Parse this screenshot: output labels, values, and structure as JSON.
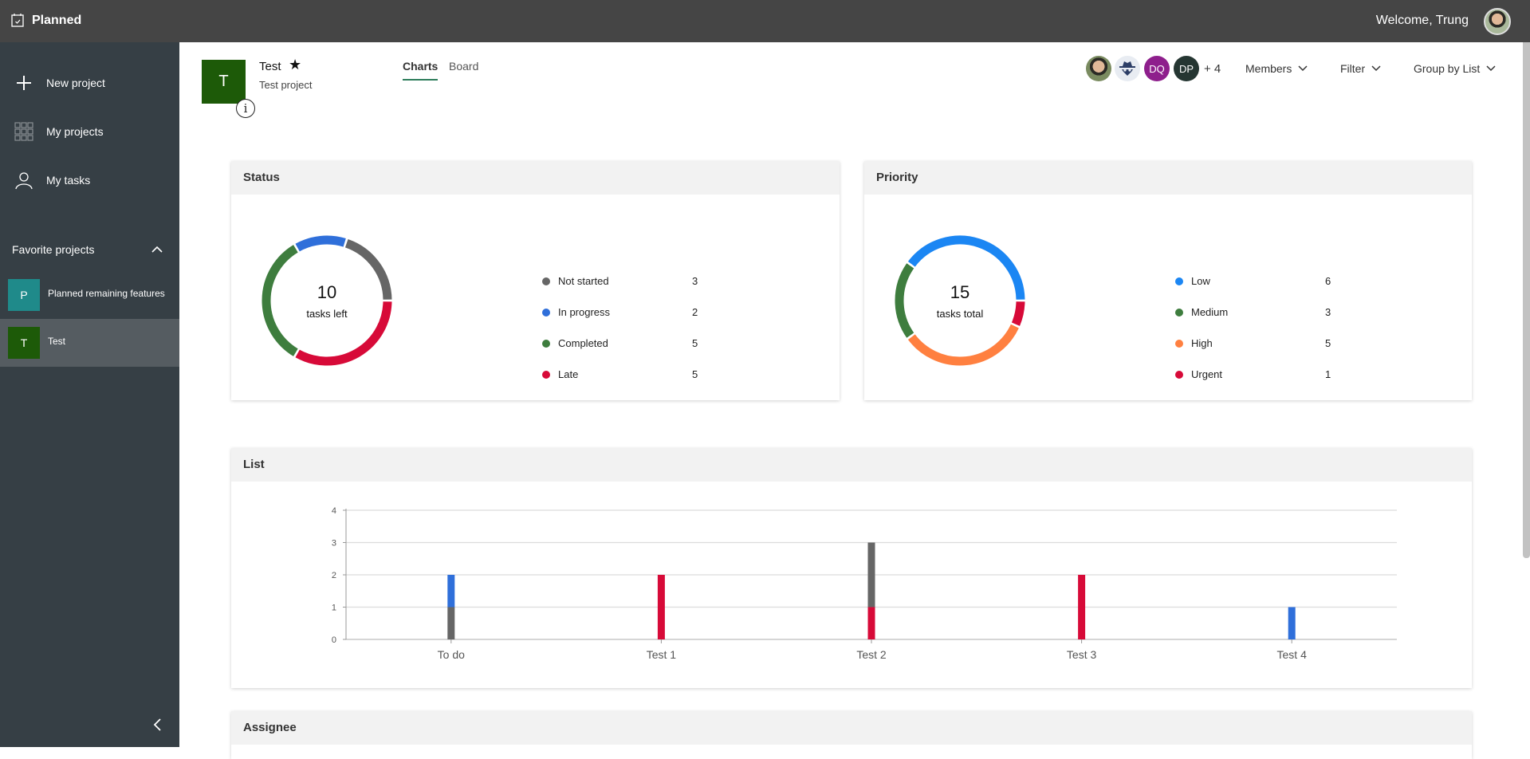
{
  "app": {
    "title": "Planned",
    "welcome": "Welcome, Trung",
    "logo_icon": "calendar-check-icon",
    "user_avatar": "user-photo-avatar"
  },
  "sidebar": {
    "nav": [
      {
        "label": "New project",
        "icon": "plus-icon"
      },
      {
        "label": "My projects",
        "icon": "grid-icon"
      },
      {
        "label": "My tasks",
        "icon": "person-icon"
      }
    ],
    "favorites_title": "Favorite projects",
    "favorites": [
      {
        "initial": "P",
        "label": "Planned remaining features",
        "color": "#1f8a8a",
        "active": false
      },
      {
        "initial": "T",
        "label": "Test",
        "color": "#1d5a08",
        "active": true
      }
    ],
    "collapse_icon": "chevron-left-icon"
  },
  "project": {
    "initial": "T",
    "name": "Test",
    "description": "Test project",
    "favorite": true,
    "color": "#1d5a08"
  },
  "tabs": [
    {
      "label": "Charts",
      "active": true
    },
    {
      "label": "Board",
      "active": false
    }
  ],
  "members": {
    "avatars": [
      {
        "type": "photo",
        "initials": ""
      },
      {
        "type": "incognito",
        "initials": ""
      },
      {
        "type": "initials",
        "initials": "DQ",
        "color": "#8e1f8c"
      },
      {
        "type": "initials",
        "initials": "DP",
        "color": "#253632"
      }
    ],
    "more": "+ 4"
  },
  "toolbar": {
    "members_label": "Members",
    "filter_label": "Filter",
    "group_label": "Group by List"
  },
  "cards": {
    "status_title": "Status",
    "priority_title": "Priority",
    "list_title": "List",
    "assignee_title": "Assignee"
  },
  "colors": {
    "not_started": "#666666",
    "in_progress": "#2f6fda",
    "completed": "#3e7d3e",
    "late": "#d70a38",
    "low": "#1b86f3",
    "medium": "#3e7d3e",
    "high": "#ff8040",
    "urgent": "#d70a38"
  },
  "chart_data": [
    {
      "type": "pie",
      "title": "Status",
      "center_value": "10",
      "center_label": "tasks left",
      "categories": [
        "Not started",
        "In progress",
        "Completed",
        "Late"
      ],
      "values": [
        3,
        2,
        5,
        5
      ],
      "draw_order": [
        "Late",
        "Completed",
        "In progress",
        "Not started"
      ],
      "legend": "right"
    },
    {
      "type": "pie",
      "title": "Priority",
      "center_value": "15",
      "center_label": "tasks total",
      "categories": [
        "Low",
        "Medium",
        "High",
        "Urgent"
      ],
      "values": [
        6,
        3,
        5,
        1
      ],
      "draw_order": [
        "Urgent",
        "High",
        "Medium",
        "Low"
      ],
      "legend": "right"
    },
    {
      "type": "bar",
      "title": "List",
      "stacked": true,
      "categories": [
        "To do",
        "Test 1",
        "Test 2",
        "Test 3",
        "Test 4"
      ],
      "series": [
        {
          "name": "Late",
          "color_key": "late",
          "values": [
            0,
            2,
            1,
            2,
            0
          ]
        },
        {
          "name": "Not started",
          "color_key": "not_started",
          "values": [
            1,
            0,
            2,
            0,
            0
          ]
        },
        {
          "name": "In progress",
          "color_key": "in_progress",
          "values": [
            1,
            0,
            0,
            0,
            1
          ]
        }
      ],
      "ylim": [
        0,
        4
      ],
      "yticks": [
        "0",
        "1",
        "2",
        "3",
        "4"
      ],
      "grid": true,
      "xlabel": "",
      "ylabel": ""
    }
  ]
}
